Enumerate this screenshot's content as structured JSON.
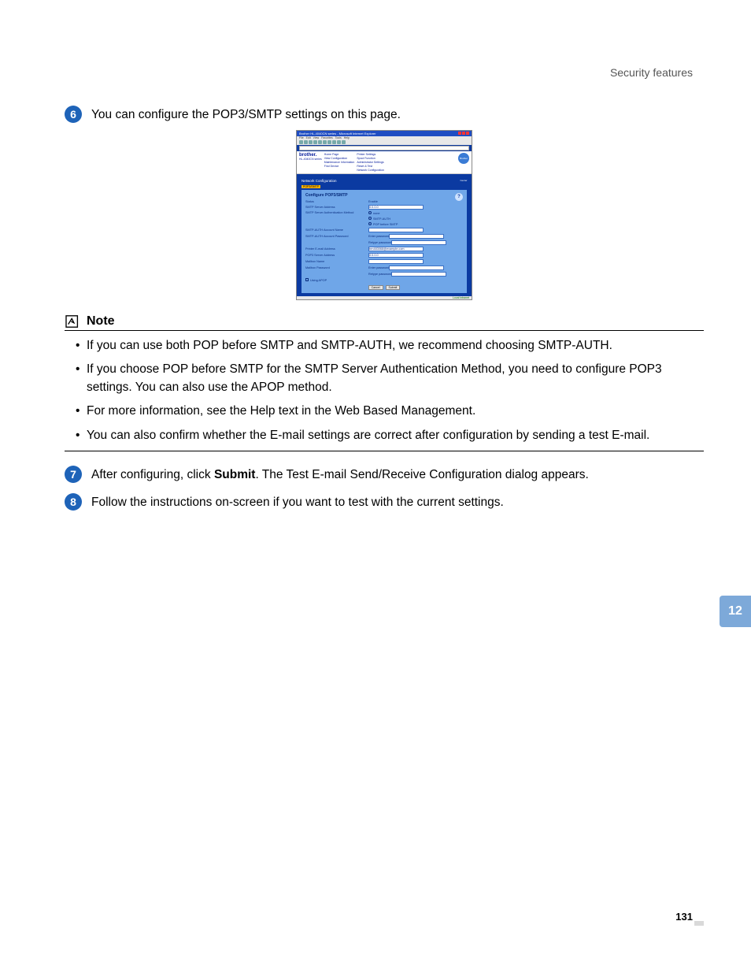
{
  "header": {
    "section_title": "Security features"
  },
  "step6": {
    "number": "6",
    "text": "You can configure the POP3/SMTP settings on this page."
  },
  "screenshot": {
    "ie_title": "Brother HL-4040CN series - Microsoft Internet Explorer",
    "ie_menu": [
      "File",
      "Edit",
      "View",
      "Favorites",
      "Tools",
      "Help"
    ],
    "brand": "brother.",
    "model": "HL-4040CN series",
    "nav_col1": [
      "Home Page",
      "View Configuration",
      "Maintenance Information",
      "Find Device"
    ],
    "nav_col2": [
      "Printer Settings",
      "Spool Function",
      "Administrator Settings",
      "Reset & Test",
      "Network Configuration"
    ],
    "gear_label": "Brother Solutions Center",
    "section": "Network Configuration",
    "tab": "POP3/SMTP",
    "panel_title": "Configure POP3/SMTP",
    "rows": {
      "status_label": "Status",
      "status_value": "Enable",
      "smtp_server_label": "SMTP Server Address",
      "smtp_server_value": "0.0.0.0",
      "smtp_auth_label": "SMTP Server Authentication Method",
      "auth_none": "none",
      "auth_smtp": "SMTP-AUTH",
      "auth_pop": "POP before SMTP",
      "smtp_acct_name": "SMTP-AUTH Account Name",
      "smtp_acct_pwd": "SMTP-AUTH Account Password",
      "enter_pwd": "Enter password",
      "retype_pwd": "Retype password",
      "printer_email": "Printer E-mail Address",
      "printer_email_value": "brn483068@example.com",
      "pop3_server": "POP3 Server Address",
      "pop3_server_value": "0.0.0.0",
      "mailbox_name": "Mailbox Name",
      "mailbox_pwd": "Mailbox Password",
      "using_apop": "Using APOP",
      "cancel": "Cancel",
      "submit": "Submit"
    },
    "status_bar": "Local intranet"
  },
  "note": {
    "label": "Note",
    "items": [
      "If you can use both POP before SMTP and SMTP-AUTH, we recommend choosing SMTP-AUTH.",
      "If you choose POP before SMTP for the SMTP Server Authentication Method, you need to configure POP3 settings. You can also use the APOP method.",
      "For more information, see the Help text in the Web Based Management.",
      "You can also confirm whether the E-mail settings are correct after configuration by sending a test E-mail."
    ]
  },
  "step7": {
    "number": "7",
    "text_before": "After configuring, click ",
    "bold": "Submit",
    "text_after": ". The Test E-mail Send/Receive Configuration dialog appears."
  },
  "step8": {
    "number": "8",
    "text": "Follow the instructions on-screen if you want to test with the current settings."
  },
  "chapter_tab": "12",
  "page_number": "131"
}
